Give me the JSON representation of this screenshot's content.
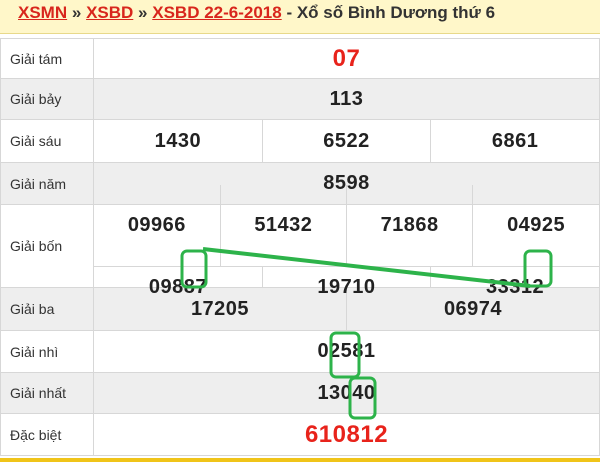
{
  "breadcrumb": {
    "link1": "XSMN",
    "sep1": "»",
    "link2": "XSBD",
    "sep2": "»",
    "link3": "XSBD 22-6-2018",
    "sep3": "-",
    "title": "Xổ số Bình Dương thứ 6"
  },
  "rows": {
    "g8": {
      "label": "Giải tám",
      "values": [
        "07"
      ]
    },
    "g7": {
      "label": "Giải bảy",
      "values": [
        "113"
      ]
    },
    "g6": {
      "label": "Giải sáu",
      "values": [
        "1430",
        "6522",
        "6861"
      ]
    },
    "g5": {
      "label": "Giải năm",
      "values": [
        "8598"
      ]
    },
    "g4": {
      "label": "Giải bốn",
      "values": [
        "09966",
        "51432",
        "71868",
        "04925",
        "09887",
        "19710",
        "33312"
      ]
    },
    "g3": {
      "label": "Giải ba",
      "values": [
        "17205",
        "06974"
      ]
    },
    "g2": {
      "label": "Giải nhì",
      "values": [
        "02581"
      ]
    },
    "g1": {
      "label": "Giải nhất",
      "values": [
        "13040"
      ]
    },
    "db": {
      "label": "Đặc biệt",
      "values": [
        "610812"
      ]
    }
  },
  "colors": {
    "red": "#e8231b",
    "link": "#d8261c",
    "header_bg": "#fff7c9",
    "alt_row": "#eeeeee",
    "highlight": "#2db34a"
  }
}
